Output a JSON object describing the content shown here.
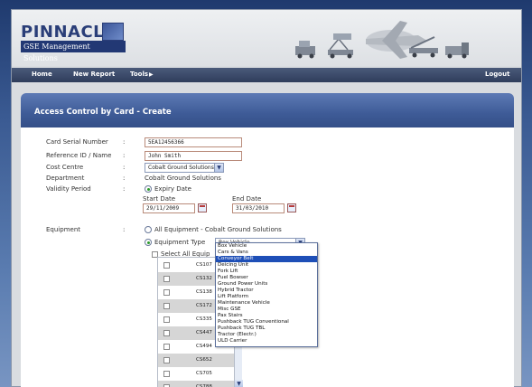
{
  "brand": {
    "name": "PINNACLE",
    "tagline": "GSE Management Solutions"
  },
  "nav": {
    "home": "Home",
    "new_report": "New Report",
    "tools": "Tools",
    "logout": "Logout"
  },
  "section": {
    "title": "Access Control by Card - Create"
  },
  "form": {
    "card_serial_label": "Card Serial Number",
    "card_serial_value": "5EA12456366",
    "reference_label": "Reference ID / Name",
    "reference_value": "John Smith",
    "cost_centre_label": "Cost Centre",
    "cost_centre_value": "Cobalt Ground Solutions",
    "department_label": "Department",
    "department_value": "Cobalt Ground Solutions",
    "validity_label": "Validity Period",
    "expiry_option": "Expiry Date",
    "start_date_label": "Start Date",
    "start_date_value": "29/11/2009",
    "end_date_label": "End Date",
    "end_date_value": "31/03/2010",
    "equipment_label": "Equipment",
    "all_equipment_option": "All Equipment - Cobalt Ground Solutions",
    "equipment_type_option": "Equipment Type",
    "equipment_type_value": "Box Vehicle",
    "select_all_label": "Select All Equip",
    "colon": ":"
  },
  "equipment_rows": [
    "CS107",
    "CS132",
    "CS138",
    "CS172",
    "CS335",
    "CS447",
    "CS494",
    "CS652",
    "CS705",
    "CS788"
  ],
  "equipment_types": [
    "Box Vehicle",
    "Cars & Vans",
    "Conveyor Belt",
    "Deicing Unit",
    "Fork Lift",
    "Fuel Bowser",
    "Ground Power Units",
    "Hybrid Tractor",
    "Lift Platform",
    "Maintenance Vehicle",
    "Misc GSE",
    "Pax Stairs",
    "Pushback TUG Conventional",
    "Pushback TUG TBL",
    "Tractor (Electr.)",
    "ULD Carrier"
  ],
  "highlighted_type": "Conveyor Belt",
  "colors": {
    "accent": "#3e5b97",
    "highlight": "#1e4fb7",
    "nav": "#2f3d5b"
  }
}
